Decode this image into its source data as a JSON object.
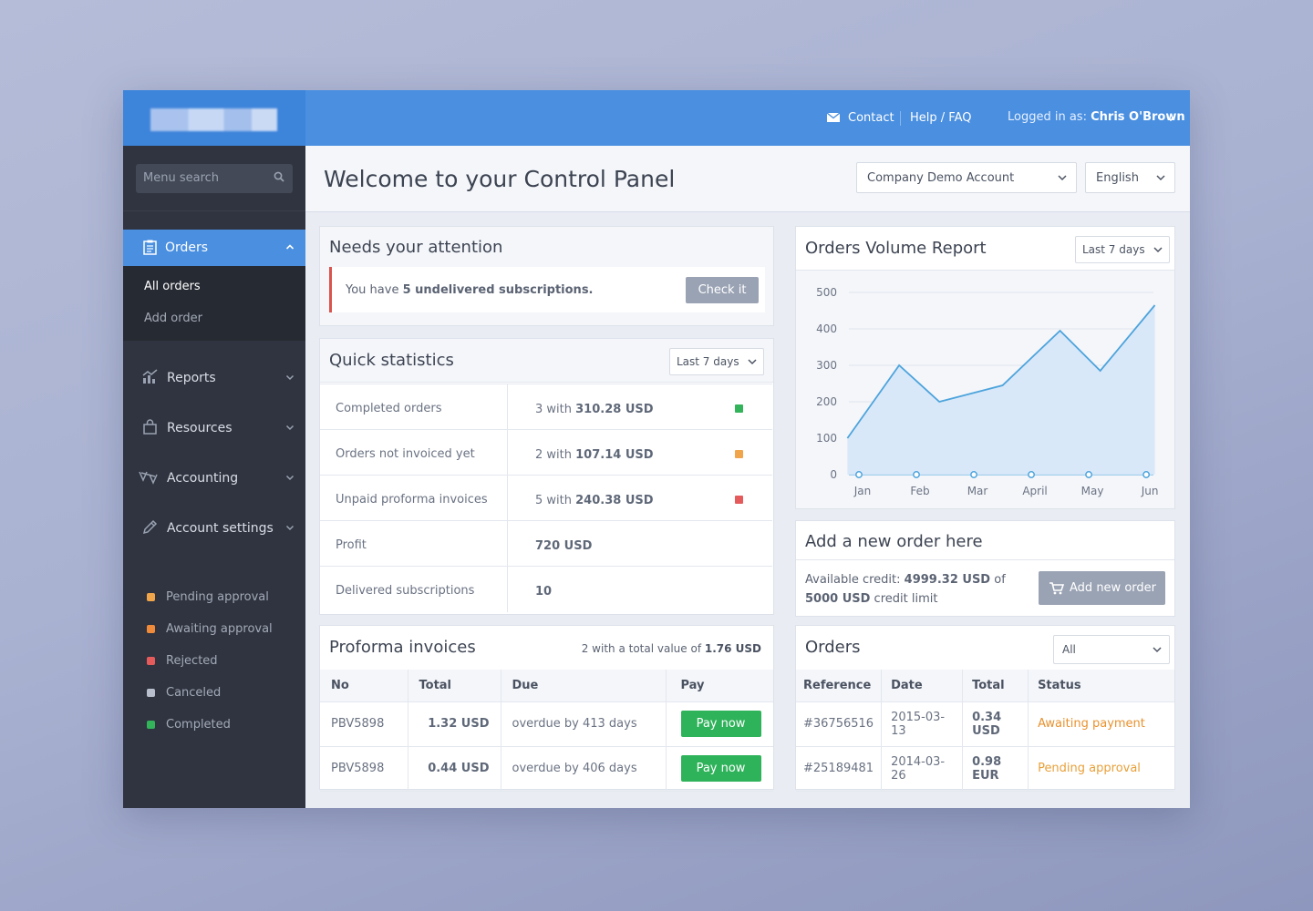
{
  "topbar": {
    "contact": "Contact",
    "help": "Help / FAQ",
    "logged_in_label": "Logged in as:",
    "user_name": "Chris O'Brown"
  },
  "sidebar": {
    "search_placeholder": "Menu search",
    "active_section": "Orders",
    "submenu": [
      "All orders",
      "Add order"
    ],
    "items": [
      {
        "label": "Reports",
        "icon": "chart-icon"
      },
      {
        "label": "Resources",
        "icon": "bag-icon"
      },
      {
        "label": "Accounting",
        "icon": "scale-icon"
      },
      {
        "label": "Account settings",
        "icon": "pencil-icon"
      }
    ],
    "legend": [
      {
        "label": "Pending approval",
        "color": "#f0a54a"
      },
      {
        "label": "Awaiting approval",
        "color": "#ef8a3a"
      },
      {
        "label": "Rejected",
        "color": "#e55b5b"
      },
      {
        "label": "Canceled",
        "color": "#b9bfcc"
      },
      {
        "label": "Completed",
        "color": "#33b35a"
      }
    ]
  },
  "header": {
    "title": "Welcome to your Control Panel",
    "account_select": "Company Demo Account",
    "language_select": "English"
  },
  "attention": {
    "title": "Needs your attention",
    "text_prefix": "You have ",
    "text_bold": "5 undelivered subscriptions.",
    "button": "Check it"
  },
  "quick_stats": {
    "title": "Quick statistics",
    "range": "Last 7 days",
    "rows": [
      {
        "label": "Completed orders",
        "count": "3 with ",
        "amount": "310.28 USD",
        "color": "#33b35a"
      },
      {
        "label": "Orders not invoiced yet",
        "count": "2 with ",
        "amount": "107.14 USD",
        "color": "#f0a54a"
      },
      {
        "label": "Unpaid proforma invoices",
        "count": "5 with ",
        "amount": "240.38 USD",
        "color": "#e55b5b"
      },
      {
        "label": "Profit",
        "count": "",
        "amount": "720 USD",
        "color": ""
      },
      {
        "label": "Delivered subscriptions",
        "count": "",
        "amount": "10",
        "color": ""
      }
    ]
  },
  "proforma": {
    "title": "Proforma invoices",
    "summary_prefix": "2 with a total value of ",
    "summary_value": "1.76 USD",
    "columns": [
      "No",
      "Total",
      "Due",
      "Pay"
    ],
    "rows": [
      {
        "no": "PBV5898",
        "total": "1.32 USD",
        "due": "overdue by 413 days",
        "pay": "Pay now"
      },
      {
        "no": "PBV5898",
        "total": "0.44 USD",
        "due": "overdue by 406 days",
        "pay": "Pay now"
      }
    ]
  },
  "volume_report": {
    "title": "Orders Volume Report",
    "range": "Last 7 days"
  },
  "chart_data": {
    "type": "area",
    "categories": [
      "Jan",
      "Feb",
      "Mar",
      "April",
      "May",
      "Jun"
    ],
    "x_ticks_positions_note": "",
    "y_ticks": [
      0,
      100,
      200,
      300,
      400,
      500
    ],
    "ylim": [
      0,
      500
    ],
    "series": [
      {
        "values": [
          100,
          300,
          200,
          245,
          395,
          285,
          465
        ],
        "x": [
          -0.2,
          0.7,
          1.4,
          2.5,
          3.5,
          4.2,
          5.15
        ]
      },
      {
        "values": [
          0,
          0,
          0,
          0,
          0,
          0
        ],
        "x": [
          0,
          1,
          2,
          3,
          4,
          5
        ]
      }
    ],
    "colors": {
      "line": "#4ea4dc",
      "fill": "#d6e7f8"
    }
  },
  "new_order": {
    "title": "Add a new order here",
    "credit_prefix": "Available credit: ",
    "credit_value": "4999.32 USD",
    "credit_of": " of",
    "limit_value": "5000 USD",
    "limit_suffix": " credit limit",
    "button": "Add new order"
  },
  "orders": {
    "title": "Orders",
    "filter": "All",
    "columns": [
      "Reference",
      "Date",
      "Total",
      "Status"
    ],
    "rows": [
      {
        "ref": "#36756516",
        "date": "2015-03-13",
        "total": "0.34 USD",
        "status": "Awaiting payment",
        "status_color": "#e8922e"
      },
      {
        "ref": "#25189481",
        "date": "2014-03-26",
        "total": "0.98 EUR",
        "status": "Pending approval",
        "status_color": "#e8a03a"
      }
    ]
  }
}
